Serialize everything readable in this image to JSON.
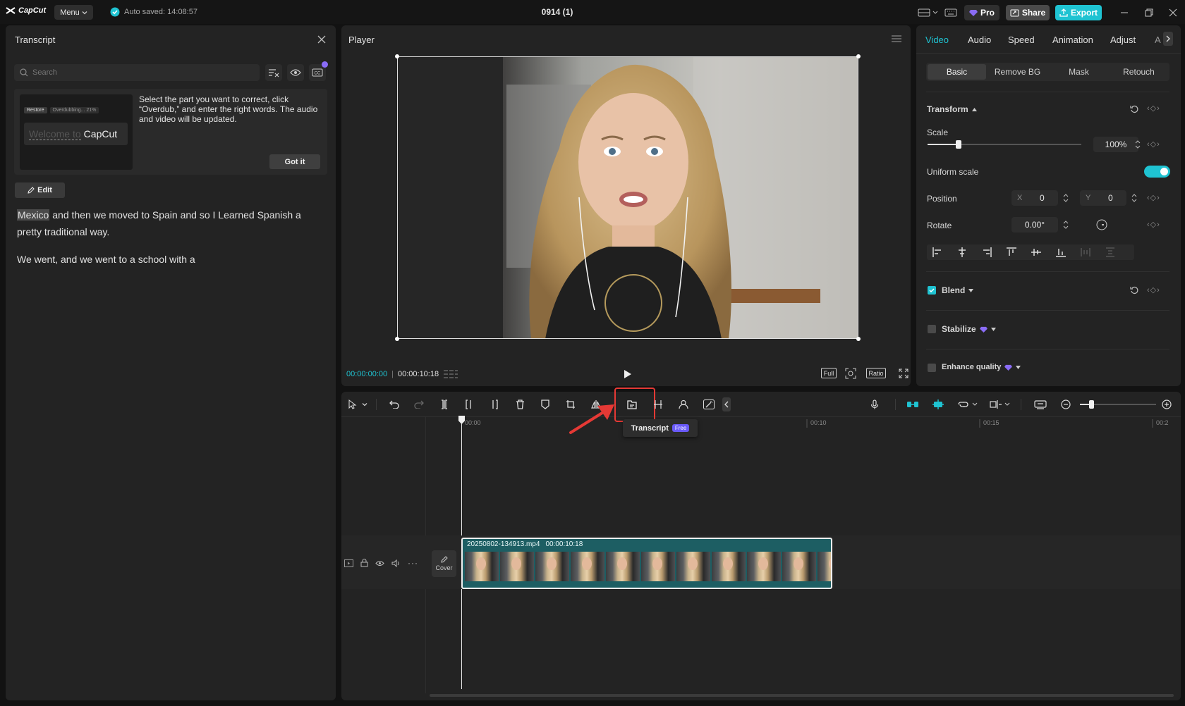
{
  "app": {
    "logo": "CapCut",
    "menu_label": "Menu",
    "autosave": "Auto saved: 14:08:57",
    "project_title": "0914 (1)",
    "pro_label": "Pro",
    "share_label": "Share",
    "export_label": "Export"
  },
  "transcript_panel": {
    "title": "Transcript",
    "search_placeholder": "Search",
    "tip_preview_restore": "Restore",
    "tip_preview_progress": "Overdubbing... 21%",
    "tip_preview_ghost": "Welcome to",
    "tip_preview_word": "CapCut",
    "tip_text": "Select the part you want to correct, click “Overdub,” and enter the right words. The audio and video will be updated.",
    "got_it": "Got it",
    "edit_label": "Edit",
    "highlight_word": "Mexico",
    "para1_rest": " and then we moved to Spain and so I Learned Spanish a pretty traditional way.",
    "para2": "We went, and we went to a school with a"
  },
  "player": {
    "title": "Player",
    "current_time": "00:00:00:00",
    "total_time": "00:00:10:18",
    "full_label": "Full",
    "ratio_label": "Ratio"
  },
  "inspector": {
    "tabs": [
      "Video",
      "Audio",
      "Speed",
      "Animation",
      "Adjust",
      "A"
    ],
    "subtabs": [
      "Basic",
      "Remove BG",
      "Mask",
      "Retouch"
    ],
    "transform_label": "Transform",
    "scale_label": "Scale",
    "scale_value": "100%",
    "scale_fraction": 0.2,
    "uniform_scale_label": "Uniform scale",
    "position_label": "Position",
    "pos_x_label": "X",
    "pos_x": "0",
    "pos_y_label": "Y",
    "pos_y": "0",
    "rotate_label": "Rotate",
    "rotate_value": "0.00°",
    "blend_label": "Blend",
    "stabilize_label": "Stabilize",
    "enhance_label": "Enhance quality"
  },
  "timeline": {
    "tooltip_label": "Transcript",
    "tooltip_badge": "Free",
    "ruler": [
      "00:00",
      "00:10",
      "00:15",
      "00:2"
    ],
    "cover_label": "Cover",
    "clip_name": "20250802-134913.mp4",
    "clip_duration": "00:00:10:18"
  },
  "colors": {
    "accent": "#1fc3d2",
    "highlight_box": "#e53935",
    "pro_badge": "#8a6cf7"
  }
}
